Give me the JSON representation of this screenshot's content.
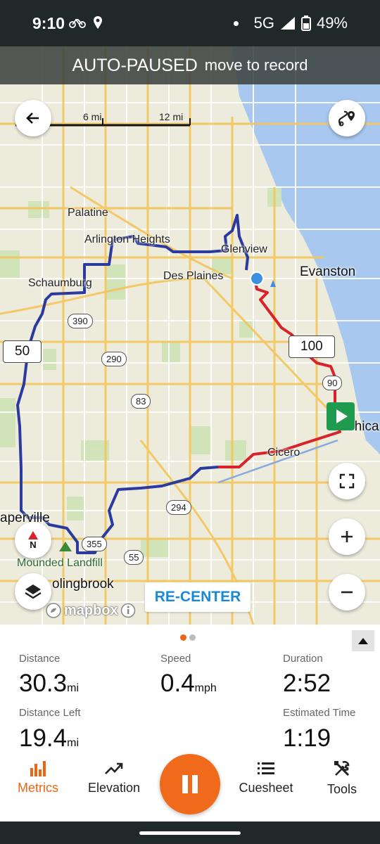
{
  "status_bar": {
    "time": "9:10",
    "network": "5G",
    "battery": "49%",
    "icons": [
      "cycling-icon",
      "location-icon",
      "notification-dot",
      "signal-icon",
      "battery-icon"
    ]
  },
  "banner": {
    "title": "AUTO-PAUSED",
    "subtitle": "move to record"
  },
  "map": {
    "scale": {
      "label_1": "6 mi",
      "label_2": "12 mi"
    },
    "place_labels": [
      "Palatine",
      "Arlington Heights",
      "Glenview",
      "Des Plaines",
      "Evanston",
      "Schaumburg",
      "Cicero",
      "Chica",
      "aperville",
      "olingbrook",
      "Mounded Landfill"
    ],
    "route_shields": [
      "390",
      "290",
      "83",
      "90",
      "294",
      "355",
      "55"
    ],
    "mile_markers": [
      "50",
      "100"
    ],
    "recenter_label": "RE-CENTER",
    "attribution": "mapbox",
    "compass_label": "N",
    "colors": {
      "route_done": "#2b3a9e",
      "route_ahead": "#d9232a",
      "water": "#a8c8f0",
      "start_flag": "#1f9a4f",
      "location_dot": "#3d8fe0"
    }
  },
  "metrics": {
    "distance": {
      "label": "Distance",
      "value": "30.3",
      "unit": "mi"
    },
    "speed": {
      "label": "Speed",
      "value": "0.4",
      "unit": "mph"
    },
    "duration": {
      "label": "Duration",
      "value": "2:52"
    },
    "distance_left": {
      "label": "Distance Left",
      "value": "19.4",
      "unit": "mi"
    },
    "estimated_time": {
      "label": "Estimated Time",
      "value": "1:19"
    },
    "page_count": 2,
    "active_page": 1
  },
  "nav": {
    "metrics": "Metrics",
    "elevation": "Elevation",
    "cuesheet": "Cuesheet",
    "tools": "Tools",
    "accent": "#ee6413"
  }
}
